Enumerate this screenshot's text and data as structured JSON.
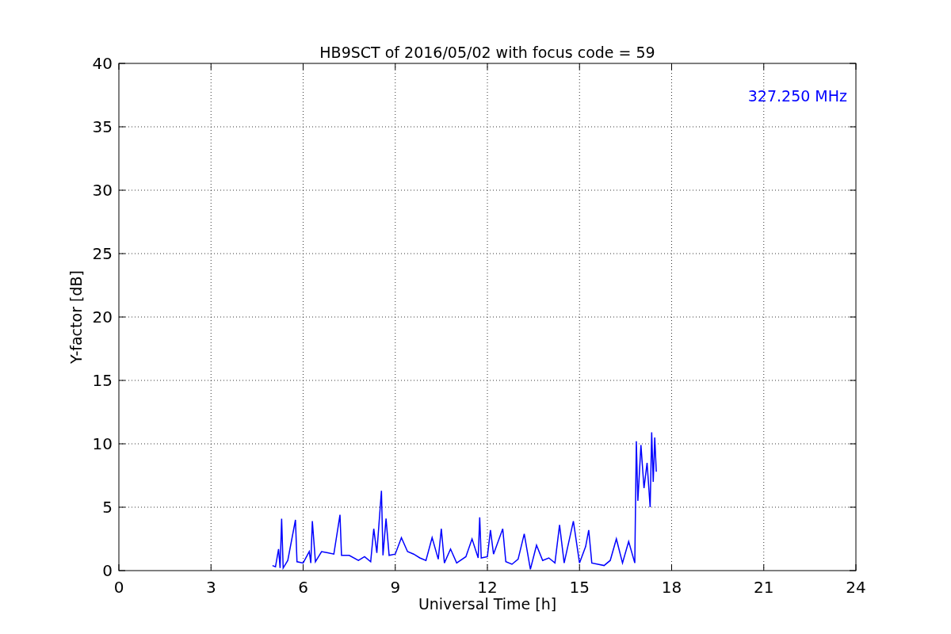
{
  "chart_data": {
    "type": "line",
    "title": "HB9SCT of 2016/05/02 with focus code = 59",
    "xlabel": "Universal Time [h]",
    "ylabel": "Y-factor [dB]",
    "x": [
      5.0,
      5.1,
      5.2,
      5.25,
      5.3,
      5.35,
      5.5,
      5.75,
      5.8,
      6.0,
      6.2,
      6.25,
      6.3,
      6.4,
      6.6,
      6.8,
      7.0,
      7.2,
      7.25,
      7.5,
      7.8,
      8.0,
      8.2,
      8.3,
      8.4,
      8.55,
      8.6,
      8.7,
      8.8,
      9.0,
      9.2,
      9.4,
      9.6,
      9.8,
      10.0,
      10.2,
      10.4,
      10.5,
      10.6,
      10.8,
      11.0,
      11.3,
      11.5,
      11.7,
      11.75,
      11.8,
      12.0,
      12.1,
      12.2,
      12.5,
      12.6,
      12.8,
      13.0,
      13.2,
      13.4,
      13.6,
      13.8,
      14.0,
      14.2,
      14.35,
      14.5,
      14.8,
      15.0,
      15.2,
      15.3,
      15.4,
      15.6,
      15.8,
      16.0,
      16.2,
      16.4,
      16.6,
      16.8,
      16.85,
      16.9,
      17.0,
      17.1,
      17.2,
      17.3,
      17.35,
      17.4,
      17.45,
      17.5
    ],
    "series": [
      {
        "name": "327.250 MHz",
        "color": "#0000ff",
        "values": [
          0.4,
          0.3,
          1.7,
          0.2,
          4.1,
          0.2,
          0.8,
          4.0,
          0.7,
          0.6,
          1.5,
          0.6,
          3.9,
          0.7,
          1.5,
          1.4,
          1.3,
          4.4,
          1.2,
          1.2,
          0.8,
          1.1,
          0.7,
          3.3,
          1.4,
          6.3,
          1.2,
          4.1,
          1.2,
          1.3,
          2.6,
          1.5,
          1.3,
          1.0,
          0.8,
          2.6,
          0.9,
          3.3,
          0.6,
          1.7,
          0.6,
          1.1,
          2.5,
          1.0,
          4.2,
          1.0,
          1.1,
          3.2,
          1.3,
          3.3,
          0.7,
          0.5,
          0.9,
          2.9,
          0.1,
          2.0,
          0.8,
          1.0,
          0.6,
          3.6,
          0.6,
          3.9,
          0.6,
          1.9,
          3.2,
          0.6,
          0.5,
          0.4,
          0.8,
          2.5,
          0.6,
          2.3,
          0.6,
          10.2,
          5.5,
          9.9,
          6.5,
          8.5,
          5.0,
          10.9,
          7.0,
          10.5,
          7.8
        ]
      }
    ],
    "xlim": [
      0,
      24
    ],
    "ylim": [
      0,
      40
    ],
    "xticks": [
      0,
      3,
      6,
      9,
      12,
      15,
      18,
      21,
      24
    ],
    "yticks": [
      0,
      5,
      10,
      15,
      20,
      25,
      30,
      35,
      40
    ],
    "grid": true
  }
}
